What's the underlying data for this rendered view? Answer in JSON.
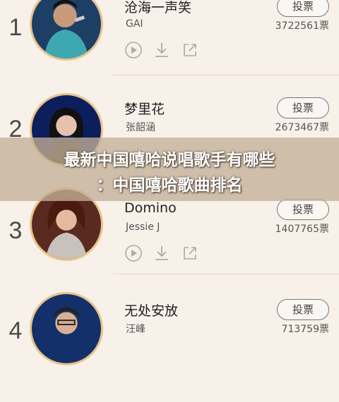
{
  "songs": [
    {
      "rank": "1",
      "title": "沧海一声笑",
      "artist": "GAI",
      "votes": "3722561票",
      "vote_label": "投票"
    },
    {
      "rank": "2",
      "title": "梦里花",
      "artist": "张韶涵",
      "votes": "2673467票",
      "vote_label": "投票"
    },
    {
      "rank": "3",
      "title": "Domino",
      "artist": "Jessie J",
      "votes": "1407765票",
      "vote_label": "投票"
    },
    {
      "rank": "4",
      "title": "无处安放",
      "artist": "汪峰",
      "votes": "713759票",
      "vote_label": "投票"
    }
  ],
  "icons": [
    "play-icon",
    "download-icon",
    "share-icon"
  ],
  "banner": {
    "line1": "最新中国嘻哈说唱歌手有哪些",
    "line2": "：中国嘻哈歌曲排名"
  },
  "colors": {
    "background": "#f7f1ea",
    "avatar_border": "#e7c48a",
    "banner_overlay": "#c4b096"
  }
}
